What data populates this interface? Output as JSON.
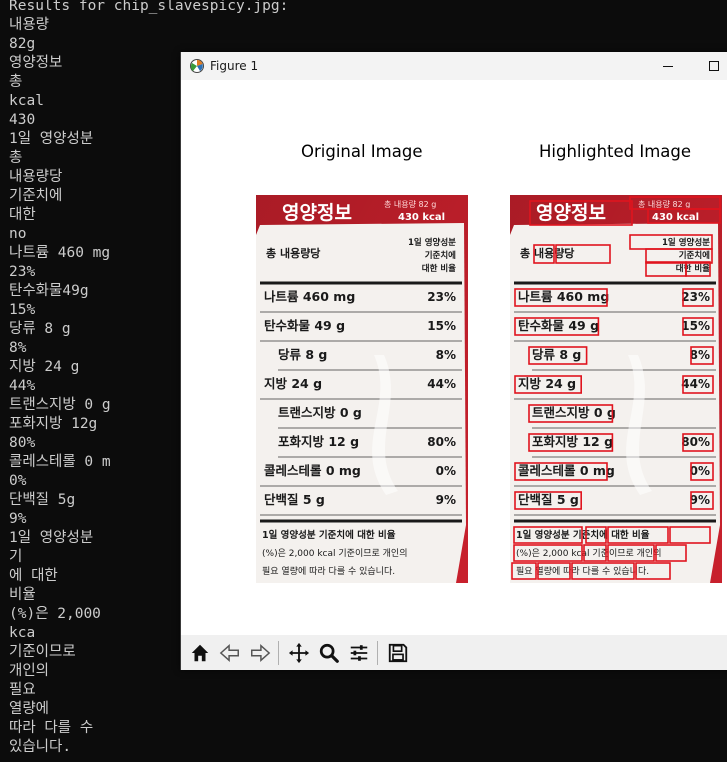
{
  "terminal": {
    "lines": [
      "Results for chip_slavespicy.jpg:",
      "내용량",
      "82g",
      "영양정보",
      "총",
      "kcal",
      "430",
      "1일 영양성분",
      "총",
      "내용량당",
      "기준치에",
      "대한",
      "no",
      "나트륨 460 mg",
      "23%",
      "탄수화물49g",
      "15%",
      "당류 8 g",
      "8%",
      "지방 24 g",
      "44%",
      "트랜스지방 0 g",
      "포화지방 12g",
      "80%",
      "콜레스테롤 0 m",
      "0%",
      "단백질 5g",
      "9%",
      "1일 영양성분",
      "기",
      "에 대한",
      "비율",
      "(%)은 2,000",
      "kca",
      "기준이므로",
      "개인의",
      "필요",
      "열량에",
      "따라 다를 수",
      "있습니다."
    ]
  },
  "window": {
    "title": "Figure 1",
    "minimize_icon": "minimize-icon",
    "maximize_icon": "maximize-icon"
  },
  "plots": {
    "left_title": "Original Image",
    "right_title": "Highlighted Image"
  },
  "label": {
    "header": "영양정보",
    "header_right_1": "총 내용량 82 g",
    "header_right_2": "430 kcal",
    "sub_left": "총 내용량당",
    "sub_right_1": "1일 영양성분",
    "sub_right_2": "기준치에",
    "sub_right_3": "대한 비율",
    "rows": [
      {
        "name": "나트륨 460 mg",
        "pct": "23%",
        "indent": false
      },
      {
        "name": "탄수화물 49 g",
        "pct": "15%",
        "indent": false
      },
      {
        "name": "당류 8 g",
        "pct": "8%",
        "indent": true
      },
      {
        "name": "지방 24 g",
        "pct": "44%",
        "indent": false
      },
      {
        "name": "트랜스지방 0 g",
        "pct": "",
        "indent": true
      },
      {
        "name": "포화지방 12 g",
        "pct": "80%",
        "indent": true
      },
      {
        "name": "콜레스테롤 0 mg",
        "pct": "0%",
        "indent": false
      },
      {
        "name": "단백질 5 g",
        "pct": "9%",
        "indent": false
      }
    ],
    "footer_1": "1일 영양성분 기준치에 대한 비율",
    "footer_2": "(%)은 2,000 kcal 기준이므로 개인의",
    "footer_3": "필요 열량에 따라 다를 수 있습니다."
  },
  "toolbar": {
    "icons": [
      "home-icon",
      "back-icon",
      "forward-icon",
      "pan-icon",
      "zoom-icon",
      "configure-subplots-icon",
      "save-icon"
    ]
  },
  "colors": {
    "terminal_bg": "#0c0c0c",
    "terminal_fg": "#cccccc",
    "package_red": "#c8202c",
    "highlight_box": "#e0141e"
  }
}
